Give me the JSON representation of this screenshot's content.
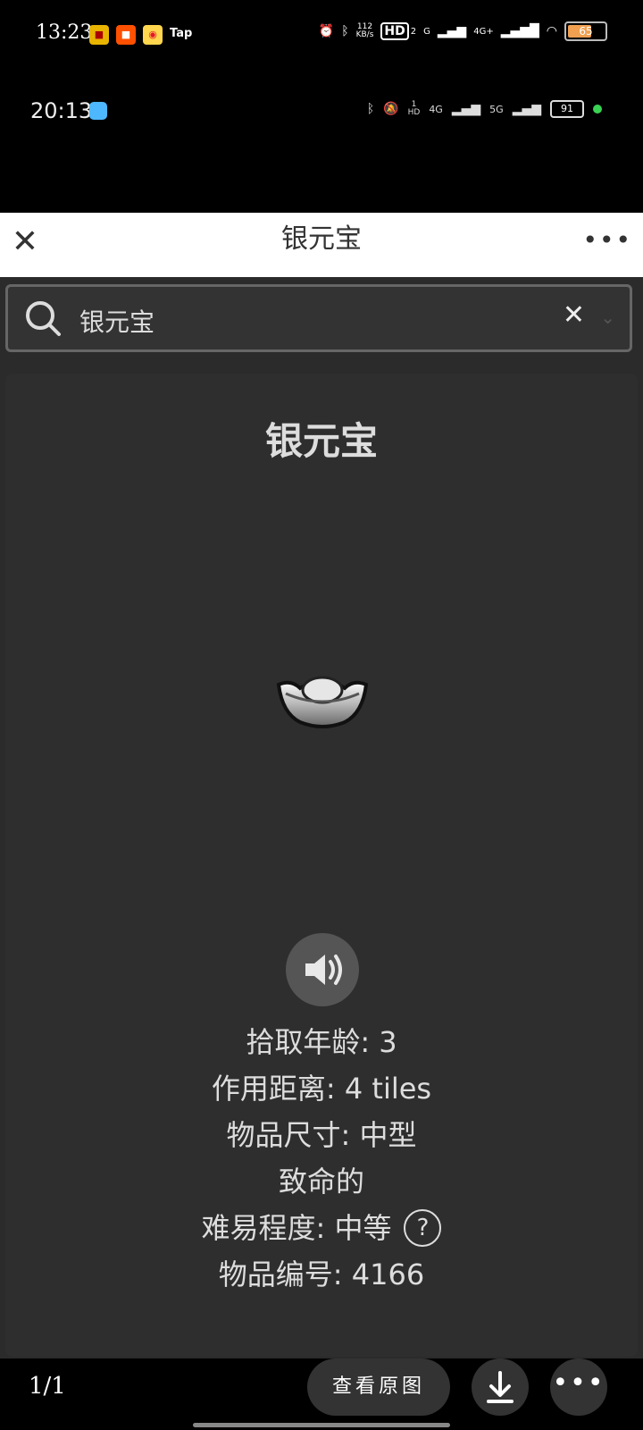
{
  "outer_status": {
    "time": "13:23",
    "apps": [
      "Tap"
    ],
    "net_speed_value": "112",
    "net_speed_unit": "KB/s",
    "hd": "HD",
    "hd_sub": "2",
    "g": "G",
    "net_4g": "4G+",
    "battery": "65"
  },
  "inner_status": {
    "time": "20:13",
    "hd_top": "1",
    "hd_bottom": "HD",
    "net_4g": "4G",
    "net_5g": "5G",
    "battery": "91"
  },
  "title_bar": {
    "title": "银元宝"
  },
  "search": {
    "value": "银元宝"
  },
  "item": {
    "name": "银元宝",
    "pickup_age": "拾取年龄: 3",
    "range": "作用距离: 4 tiles",
    "size": "物品尺寸: 中型",
    "lethal": "致命的",
    "difficulty": "难易程度: 中等",
    "difficulty_help": "?",
    "item_id": "物品编号: 4166"
  },
  "bottom_bar": {
    "pager": "1/1",
    "view_original": "查看原图"
  }
}
